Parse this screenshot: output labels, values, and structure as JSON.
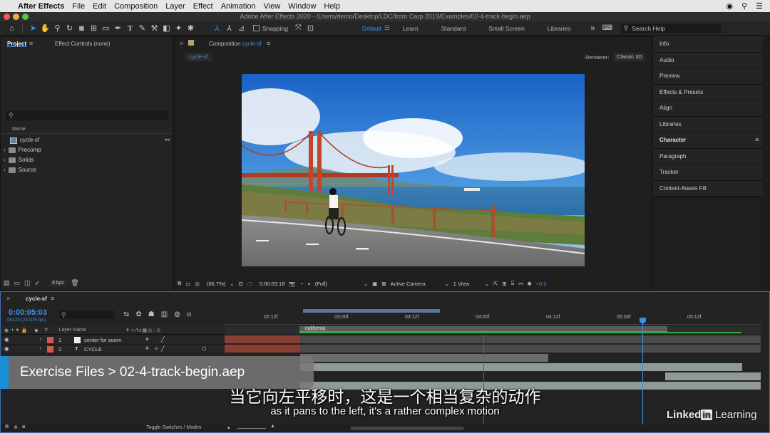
{
  "menubar": {
    "apple": "",
    "app_name": "After Effects",
    "items": [
      "File",
      "Edit",
      "Composition",
      "Layer",
      "Effect",
      "Animation",
      "View",
      "Window",
      "Help"
    ]
  },
  "window_title": "Adobe After Effects 2020 - /Users/demo/Desktop/LDC/from Carp 2019/Examples/02-4-track-begin.aep",
  "toolbar": {
    "snapping_label": "Snapping",
    "workspaces": [
      "Default",
      "Learn",
      "Standard",
      "Small Screen",
      "Libraries"
    ],
    "active_workspace": "Default",
    "search_placeholder": "Search Help"
  },
  "project_panel": {
    "tab_project": "Project",
    "tab_effect_controls": "Effect Controls (none)",
    "column_name": "Name",
    "items": [
      {
        "name": "cycle-sf",
        "type": "comp"
      },
      {
        "name": "Precomp",
        "type": "folder"
      },
      {
        "name": "Solids",
        "type": "folder"
      },
      {
        "name": "Source",
        "type": "folder"
      }
    ],
    "bpc": "8 bpc"
  },
  "composition_panel": {
    "tab_label": "Composition",
    "comp_name": "cycle-sf",
    "sub_tab": "cycle-sf",
    "renderer_label": "Renderer:",
    "renderer_value": "Classic 3D",
    "zoom": "(66.7%)",
    "timecode": "0:00:03:18",
    "resolution": "(Full)",
    "camera": "Active Camera",
    "view": "1 View",
    "exposure": "+0.0"
  },
  "right_panel": {
    "items": [
      "Info",
      "Audio",
      "Preview",
      "Effects & Presets",
      "Align",
      "Libraries",
      "Character",
      "Paragraph",
      "Tracker",
      "Content-Aware Fill"
    ],
    "bold_item": "Character"
  },
  "timeline": {
    "comp_tab": "cycle-sf",
    "current_time": "0:00:05:03",
    "frame_info": "00123 (23.976 fps)",
    "ruler_labels": [
      "02:12f",
      "03:00f",
      "03:12f",
      "04:00f",
      "04:12f",
      "05:00f",
      "05:12f"
    ],
    "marker_label": "california",
    "column_layer_name": "Layer Name",
    "column_hash": "#",
    "layers": [
      {
        "num": "1",
        "name": "center for zoom",
        "color": "#e0e0e0"
      },
      {
        "num": "2",
        "name": "CYCLE",
        "color": "#d25a4a"
      }
    ],
    "toggle_label": "Toggle Switches / Modes"
  },
  "overlay": {
    "exercise_files": "Exercise Files > 02-4-track-begin.aep",
    "subtitle_zh": "当它向左平移时，这是一个相当复杂的动作",
    "subtitle_en": "as it pans to the left, it's a rather complex motion",
    "brand": "Linked",
    "brand_in": "in",
    "brand_suffix": " Learning"
  },
  "colors": {
    "accent": "#3d8fe8",
    "exercise_bar": "#1a8fd6"
  }
}
